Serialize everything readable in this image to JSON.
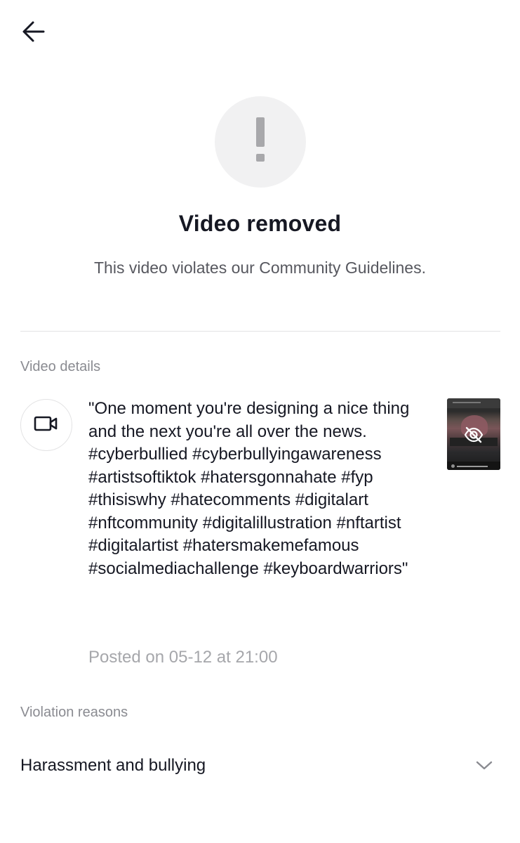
{
  "header": {
    "back_icon": "arrow-left-icon"
  },
  "status": {
    "icon": "exclamation-icon",
    "title": "Video removed",
    "subtitle": "This video violates our Community Guidelines."
  },
  "video_details": {
    "section_label": "Video details",
    "icon": "video-camera-icon",
    "caption": "\"One moment you're designing a nice thing and the next you're all over the news. #cyberbullied #cyberbullyingawareness #artistsoftiktok #hatersgonnahate #fyp #thisiswhy #hatecomments #digitalart #nftcommunity #digitalillustration #nftartist #digitalartist #hatersmakemefamous #socialmediachallenge #keyboardwarriors\"",
    "posted": "Posted on 05-12 at 21:00",
    "thumbnail_icon": "eye-slash-icon"
  },
  "violation": {
    "section_label": "Violation reasons",
    "reason": "Harassment and bullying",
    "expand_icon": "chevron-down-icon"
  },
  "colors": {
    "primary_text": "#161823",
    "secondary_text": "#57585f",
    "muted_text": "#8a8b91",
    "timestamp_text": "#a6a7ab",
    "icon_gray": "#a8a8ab",
    "circle_bg": "#f1f1f2",
    "divider": "#e3e3e4"
  }
}
